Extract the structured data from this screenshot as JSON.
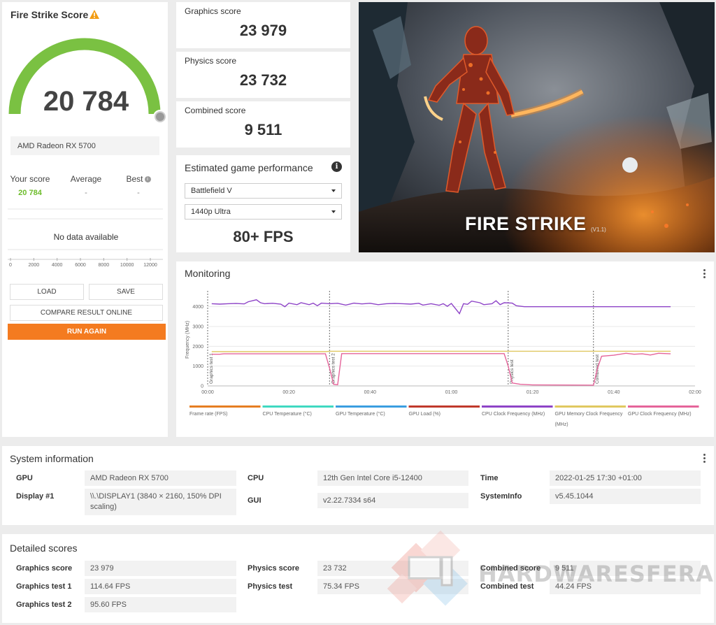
{
  "score_card": {
    "title": "Fire Strike Score",
    "warning_icon": "warning-triangle-icon",
    "score": "20 784",
    "gpu_name": "AMD Radeon RX 5700",
    "your_score_label": "Your score",
    "your_score_value": "20 784",
    "average_label": "Average",
    "average_value": "-",
    "best_label": "Best",
    "best_value": "-",
    "no_data": "No data available",
    "axis_ticks": [
      "0",
      "2000",
      "4000",
      "6000",
      "8000",
      "10000",
      "12000"
    ],
    "buttons": {
      "load": "LOAD",
      "save": "SAVE",
      "compare": "COMPARE RESULT ONLINE",
      "run_again": "RUN AGAIN"
    },
    "gauge_fill_fraction": 1.0
  },
  "scores": {
    "graphics_label": "Graphics score",
    "graphics_value": "23 979",
    "physics_label": "Physics score",
    "physics_value": "23 732",
    "combined_label": "Combined score",
    "combined_value": "9 511"
  },
  "game_perf": {
    "title": "Estimated game performance",
    "game": "Battlefield V",
    "preset": "1440p Ultra",
    "fps": "80+ FPS"
  },
  "hero": {
    "title": "FIRE STRIKE",
    "version": "(V1.1)"
  },
  "monitoring": {
    "title": "Monitoring"
  },
  "chart_data": {
    "type": "line",
    "ylabel": "Frequency (MHz)",
    "ylim": [
      0,
      4800
    ],
    "y_ticks": [
      "0",
      "1000",
      "2000",
      "3000",
      "4000"
    ],
    "x_ticks": [
      "00:00",
      "00:20",
      "00:40",
      "01:00",
      "01:20",
      "01:40",
      "02:00"
    ],
    "x_range_seconds": [
      0,
      120
    ],
    "markers": [
      {
        "label": "Graphics test 1",
        "t": 0
      },
      {
        "label": "Graphics test 2",
        "t": 30
      },
      {
        "label": "Physics test",
        "t": 74
      },
      {
        "label": "Combined test",
        "t": 95
      }
    ],
    "series": [
      {
        "name": "CPU Clock Frequency (MHz)",
        "color": "#8e44c7",
        "points": [
          [
            1,
            4150
          ],
          [
            3,
            4130
          ],
          [
            5,
            4150
          ],
          [
            7,
            4160
          ],
          [
            9,
            4140
          ],
          [
            10,
            4250
          ],
          [
            12,
            4350
          ],
          [
            13,
            4200
          ],
          [
            14,
            4150
          ],
          [
            16,
            4170
          ],
          [
            18,
            4130
          ],
          [
            19,
            4000
          ],
          [
            20,
            4180
          ],
          [
            22,
            4100
          ],
          [
            23,
            4200
          ],
          [
            25,
            4100
          ],
          [
            26,
            4180
          ],
          [
            27,
            4050
          ],
          [
            28,
            4180
          ],
          [
            30,
            4150
          ],
          [
            32,
            4170
          ],
          [
            34,
            4080
          ],
          [
            36,
            4180
          ],
          [
            38,
            4140
          ],
          [
            40,
            4170
          ],
          [
            42,
            4100
          ],
          [
            44,
            4150
          ],
          [
            46,
            4160
          ],
          [
            48,
            4150
          ],
          [
            50,
            4130
          ],
          [
            52,
            4170
          ],
          [
            53,
            4080
          ],
          [
            55,
            4150
          ],
          [
            57,
            4070
          ],
          [
            58,
            4150
          ],
          [
            59,
            4020
          ],
          [
            60,
            4160
          ],
          [
            62,
            3650
          ],
          [
            63,
            4150
          ],
          [
            64,
            4120
          ],
          [
            65,
            4280
          ],
          [
            67,
            4200
          ],
          [
            68,
            4100
          ],
          [
            70,
            4150
          ],
          [
            71,
            4300
          ],
          [
            72,
            4100
          ],
          [
            73,
            4200
          ],
          [
            75,
            4180
          ],
          [
            76,
            4050
          ],
          [
            78,
            4000
          ],
          [
            80,
            4000
          ],
          [
            90,
            4000
          ],
          [
            100,
            4000
          ],
          [
            110,
            4000
          ],
          [
            114,
            4000
          ]
        ]
      },
      {
        "name": "GPU Memory Clock Frequency (MHz)",
        "color": "#e0c860",
        "points": [
          [
            1,
            1730
          ],
          [
            29,
            1730
          ],
          [
            30,
            1750
          ],
          [
            74,
            1750
          ],
          [
            75,
            1750
          ],
          [
            95,
            1750
          ],
          [
            114,
            1750
          ]
        ]
      },
      {
        "name": "GPU Clock Frequency (MHz)",
        "color": "#e5649a",
        "points": [
          [
            1,
            1600
          ],
          [
            3,
            1600
          ],
          [
            4,
            1620
          ],
          [
            29,
            1620
          ],
          [
            30,
            900
          ],
          [
            31,
            80
          ],
          [
            32,
            60
          ],
          [
            33,
            1630
          ],
          [
            73,
            1630
          ],
          [
            74,
            1000
          ],
          [
            75,
            150
          ],
          [
            77,
            80
          ],
          [
            80,
            50
          ],
          [
            95,
            40
          ],
          [
            96,
            900
          ],
          [
            97,
            1500
          ],
          [
            100,
            1550
          ],
          [
            103,
            1650
          ],
          [
            105,
            1600
          ],
          [
            107,
            1620
          ],
          [
            109,
            1560
          ],
          [
            111,
            1650
          ],
          [
            114,
            1620
          ]
        ]
      }
    ],
    "legend": [
      {
        "name": "Frame rate (FPS)",
        "color": "#e67e22"
      },
      {
        "name": "CPU Temperature (°C)",
        "color": "#40d9c1"
      },
      {
        "name": "GPU Temperature (°C)",
        "color": "#3b9ee0"
      },
      {
        "name": "GPU Load (%)",
        "color": "#c0392b"
      },
      {
        "name": "CPU Clock Frequency (MHz)",
        "color": "#8e44c7"
      },
      {
        "name": "GPU Memory Clock Frequency (MHz)",
        "color": "#e0c860"
      },
      {
        "name": "GPU Clock Frequency (MHz)",
        "color": "#e5649a"
      }
    ]
  },
  "system_info": {
    "title": "System information",
    "gpu_label": "GPU",
    "gpu_value": "AMD Radeon RX 5700",
    "display_label": "Display #1",
    "display_value": "\\\\.\\DISPLAY1 (3840 × 2160, 150% DPI scaling)",
    "cpu_label": "CPU",
    "cpu_value": "12th Gen Intel Core i5-12400",
    "gui_label": "GUI",
    "gui_value": "v2.22.7334 s64",
    "time_label": "Time",
    "time_value": "2022-01-25 17:30 +01:00",
    "sysinfo_label": "SystemInfo",
    "sysinfo_value": "v5.45.1044"
  },
  "detailed_scores": {
    "title": "Detailed scores",
    "graphics_score_label": "Graphics score",
    "graphics_score_value": "23 979",
    "graphics_test1_label": "Graphics test 1",
    "graphics_test1_value": "114.64 FPS",
    "graphics_test2_label": "Graphics test 2",
    "graphics_test2_value": "95.60 FPS",
    "physics_score_label": "Physics score",
    "physics_score_value": "23 732",
    "physics_test_label": "Physics test",
    "physics_test_value": "75.34 FPS",
    "combined_score_label": "Combined score",
    "combined_score_value": "9 511",
    "combined_test_label": "Combined test",
    "combined_test_value": "44.24 FPS"
  },
  "watermark": {
    "text": "HARDWARESFERA"
  }
}
